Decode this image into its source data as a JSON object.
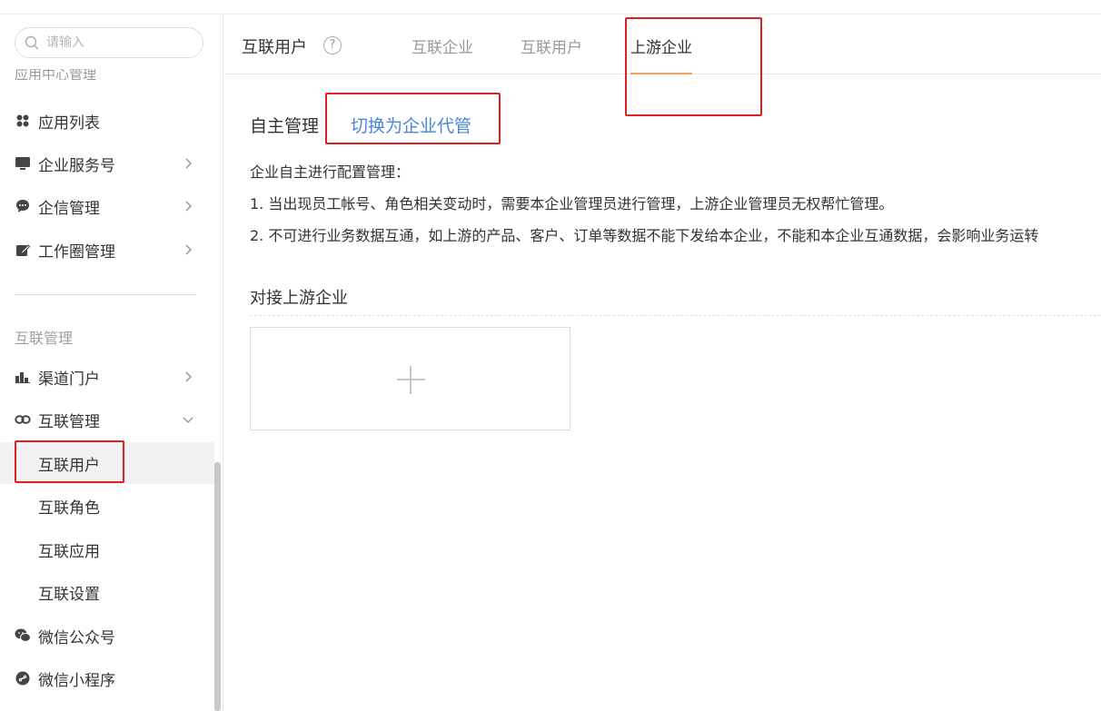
{
  "sidebar": {
    "search": {
      "placeholder": "请输入"
    },
    "cut_heading": "应用中心管理",
    "items": [
      {
        "label": "应用列表",
        "icon": "grid-icon"
      },
      {
        "label": "企业服务号",
        "icon": "monitor-icon"
      },
      {
        "label": "企信管理",
        "icon": "chat-bubble-icon"
      },
      {
        "label": "工作圈管理",
        "icon": "edit-icon"
      }
    ],
    "group_title": "互联管理",
    "group_items": [
      {
        "label": "渠道门户",
        "icon": "bar-chart-icon"
      },
      {
        "label": "互联管理",
        "icon": "link-icon"
      }
    ],
    "sub_items": [
      {
        "label": "互联用户",
        "active": true
      },
      {
        "label": "互联角色"
      },
      {
        "label": "互联应用"
      },
      {
        "label": "互联设置"
      }
    ],
    "bottom_items": [
      {
        "label": "微信公众号",
        "icon": "wechat-icon"
      },
      {
        "label": "微信小程序",
        "icon": "mini-program-icon"
      }
    ]
  },
  "header": {
    "title": "互联用户",
    "help_glyph": "?",
    "tabs": [
      {
        "label": "互联企业"
      },
      {
        "label": "互联用户"
      },
      {
        "label": "上游企业",
        "active": true
      }
    ]
  },
  "content": {
    "mode_label": "自主管理",
    "switch_link": "切换为企业代管",
    "desc_title": "企业自主进行配置管理：",
    "desc_1": "1. 当出现员工帐号、角色相关变动时，需要本企业管理员进行管理，上游企业管理员无权帮忙管理。",
    "desc_2": "2. 不可进行业务数据互通，如上游的产品、客户、订单等数据不能下发给本企业，不能和本企业互通数据，会影响业务运转",
    "section_title": "对接上游企业"
  },
  "colors": {
    "accent_link": "#4a86d6",
    "tab_underline": "#f5a05a",
    "highlight": "#e02020"
  }
}
